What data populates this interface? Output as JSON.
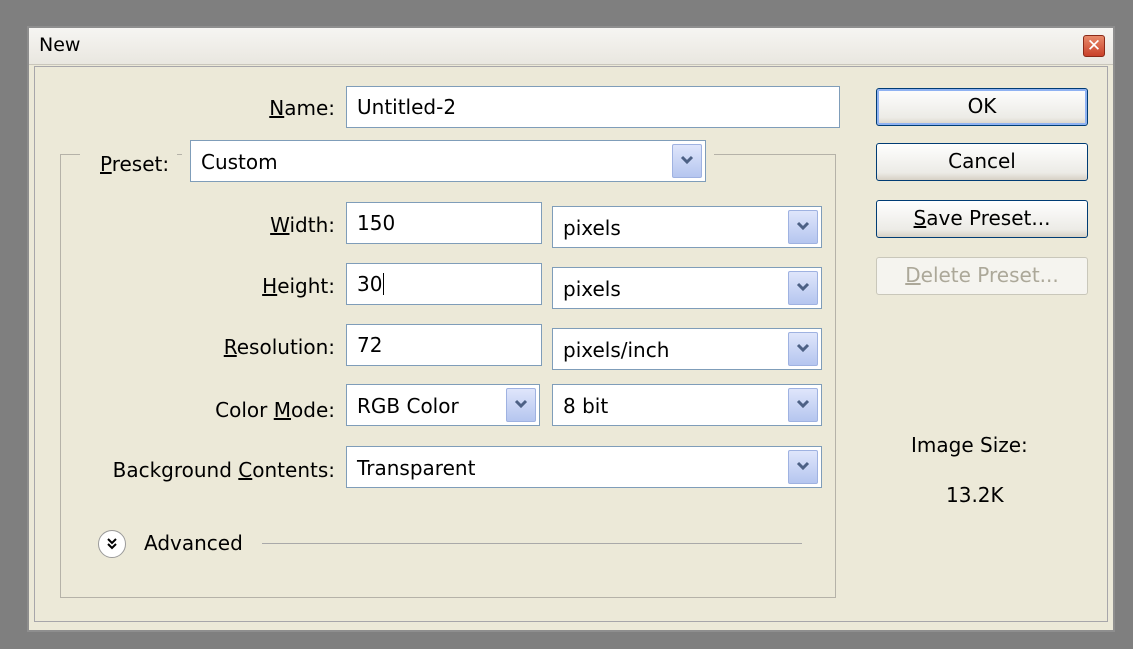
{
  "window": {
    "title": "New",
    "close_icon": "close-icon"
  },
  "form": {
    "name_label_u": "N",
    "name_label_rest": "ame:",
    "name_value": "Untitled-2",
    "preset_label_u": "P",
    "preset_label_rest": "reset:",
    "preset_value": "Custom",
    "width_label_u": "W",
    "width_label_rest": "idth:",
    "width_value": "150",
    "width_unit": "pixels",
    "height_label_u": "H",
    "height_label_rest": "eight:",
    "height_value": "30",
    "height_unit": "pixels",
    "resolution_label_u": "R",
    "resolution_label_rest": "esolution:",
    "resolution_value": "72",
    "resolution_unit": "pixels/inch",
    "color_mode_label_pre": "Color ",
    "color_mode_label_u": "M",
    "color_mode_label_rest": "ode:",
    "color_mode_value": "RGB Color",
    "bit_depth_value": "8 bit",
    "background_label_pre": "Background ",
    "background_label_u": "C",
    "background_label_rest": "ontents:",
    "background_value": "Transparent",
    "advanced_label": "Advanced"
  },
  "buttons": {
    "ok": "OK",
    "cancel": "Cancel",
    "save_preset_u": "S",
    "save_preset_rest": "ave Preset...",
    "delete_preset_u": "D",
    "delete_preset_rest": "elete Preset..."
  },
  "info": {
    "image_size_label": "Image Size:",
    "image_size_value": "13.2K"
  },
  "colors": {
    "dialog_bg": "#ece9d8",
    "input_border": "#7f9db9",
    "button_border": "#003c74",
    "disabled_text": "#aca899"
  }
}
